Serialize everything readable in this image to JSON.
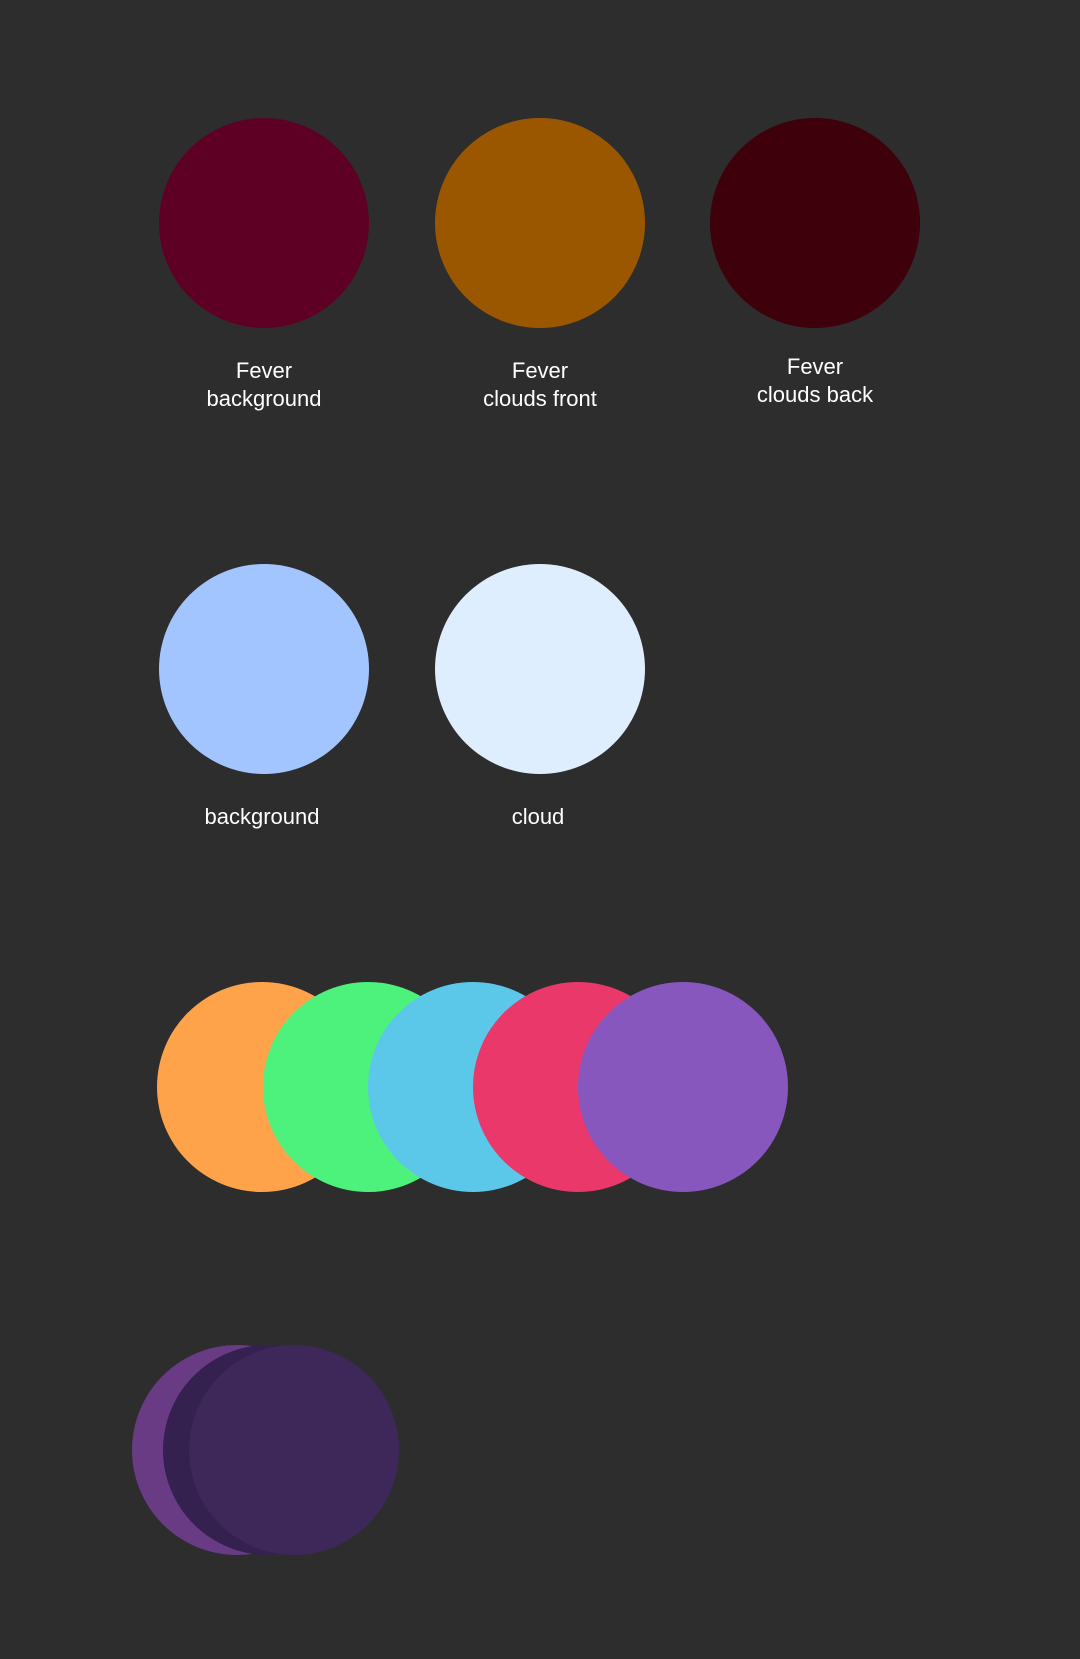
{
  "background_color": "#2d2d2d",
  "swatches_row1": [
    {
      "color": "#5e0024",
      "label_line1": "Fever",
      "label_line2": "background"
    },
    {
      "color": "#9b5700",
      "label_line1": "Fever",
      "label_line2": "clouds front"
    },
    {
      "color": "#3e000b",
      "label_line1": "Fever",
      "label_line2": "clouds back"
    }
  ],
  "swatches_row2": [
    {
      "color": "#a3c5ff",
      "label": "background"
    },
    {
      "color": "#dfeeff",
      "label": "cloud"
    }
  ],
  "swatches_row3": [
    {
      "color": "#ffa34a"
    },
    {
      "color": "#4cf27b"
    },
    {
      "color": "#5bc8ea"
    },
    {
      "color": "#ea386b"
    },
    {
      "color": "#8857be"
    }
  ],
  "swatches_row4": [
    {
      "color": "#683b84"
    },
    {
      "color": "#34214f"
    },
    {
      "color": "#3e2759"
    }
  ]
}
